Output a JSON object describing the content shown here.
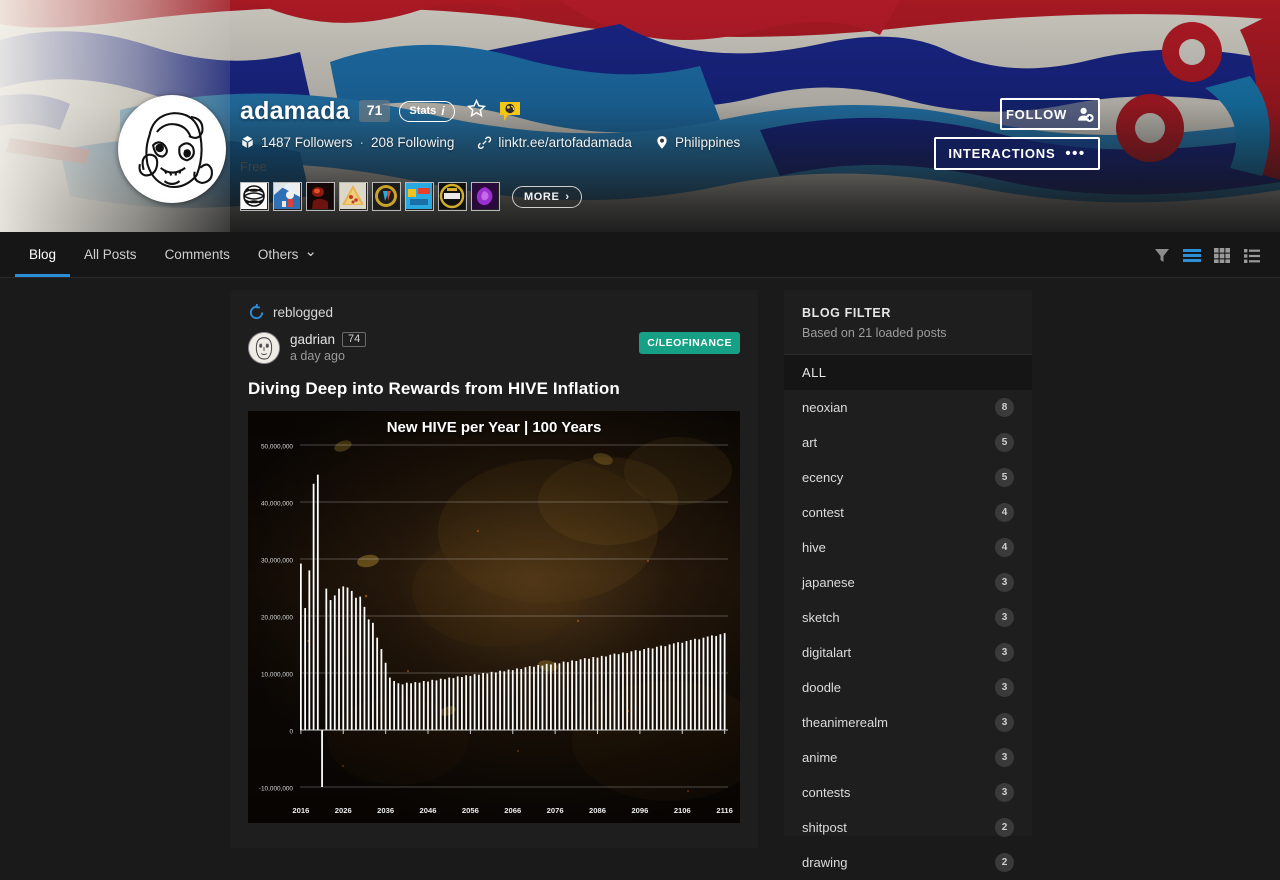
{
  "profile": {
    "username": "adamada",
    "reputation": "71",
    "stats_label": "Stats",
    "stats_info_glyph": "i",
    "followers": "1487 Followers",
    "separator": "·",
    "following": "208 Following",
    "link": "linktr.ee/artofadamada",
    "location": "Philippines",
    "free_label": "Free",
    "more_label": "MORE",
    "more_chevron": "›",
    "follow_label": "FOLLOW",
    "interactions_label": "INTERACTIONS",
    "interactions_dots": "•••",
    "icons": {
      "avatar": "avatar-line-art",
      "star": "star-icon",
      "bubble": "speech-bubble-badge-icon",
      "hive_glyph": "hive-followers-icon",
      "link": "link-icon",
      "location": "location-pin-icon",
      "follow": "add-user-icon"
    },
    "badges": [
      {
        "name": "badge-sphere",
        "c1": "#f2f2f2",
        "c2": "#141414"
      },
      {
        "name": "badge-astronaut",
        "c1": "#2f6fb5",
        "c2": "#e8e8e8"
      },
      {
        "name": "badge-dark-red",
        "c1": "#7d1414",
        "c2": "#e04a2a"
      },
      {
        "name": "badge-pizza",
        "c1": "#d8b26a",
        "c2": "#c9302c"
      },
      {
        "name": "badge-gold-circle",
        "c1": "#c9a227",
        "c2": "#1d1d1d"
      },
      {
        "name": "badge-blue-game",
        "c1": "#2aa8e0",
        "c2": "#f3c11c"
      },
      {
        "name": "badge-black-gold",
        "c1": "#d3b02a",
        "c2": "#111111"
      },
      {
        "name": "badge-purple-gem",
        "c1": "#9b30d0",
        "c2": "#2a0a3a"
      }
    ]
  },
  "nav": {
    "tabs": [
      {
        "label": "Blog",
        "name": "tab-blog",
        "active": true
      },
      {
        "label": "All Posts",
        "name": "tab-all-posts",
        "active": false
      },
      {
        "label": "Comments",
        "name": "tab-comments",
        "active": false
      },
      {
        "label": "Others",
        "name": "tab-others",
        "active": false,
        "chevron": "⌄"
      }
    ],
    "view_icons": [
      {
        "name": "filter-funnel-icon",
        "active": false
      },
      {
        "name": "list-view-icon",
        "active": true
      },
      {
        "name": "grid-view-icon",
        "active": false
      },
      {
        "name": "compact-list-view-icon",
        "active": false
      }
    ]
  },
  "post": {
    "reblogged_label": "reblogged",
    "reblog_icon": "reblog-arrow-icon",
    "author": "gadrian",
    "author_reputation": "74",
    "timestamp": "a day ago",
    "community": "C/LEOFINANCE",
    "title": "Diving Deep into Rewards from HIVE Inflation"
  },
  "chart_data": {
    "type": "bar",
    "title": "New HIVE per Year | 100 Years",
    "xlabel": "",
    "ylabel": "",
    "ylim": [
      -10000000,
      50000000
    ],
    "yticks": [
      50000000,
      40000000,
      30000000,
      20000000,
      10000000,
      0,
      -10000000
    ],
    "ytick_labels": [
      "50,000,000",
      "40,000,000",
      "30,000,000",
      "20,000,000",
      "10,000,000",
      "0",
      "-10,000,000"
    ],
    "xticks": [
      2016,
      2026,
      2036,
      2046,
      2056,
      2066,
      2076,
      2086,
      2096,
      2106,
      2116
    ],
    "xtick_labels": [
      "2016",
      "2026",
      "2036",
      "2046",
      "2056",
      "2066",
      "2076",
      "2086",
      "2096",
      "2106",
      "2116"
    ],
    "grid": true,
    "bar_color": "#ffffff",
    "x": [
      2016,
      2017,
      2018,
      2019,
      2020,
      2021,
      2022,
      2023,
      2024,
      2025,
      2026,
      2027,
      2028,
      2029,
      2030,
      2031,
      2032,
      2033,
      2034,
      2035,
      2036,
      2037,
      2038,
      2039,
      2040,
      2041,
      2042,
      2043,
      2044,
      2045,
      2046,
      2047,
      2048,
      2049,
      2050,
      2051,
      2052,
      2053,
      2054,
      2055,
      2056,
      2057,
      2058,
      2059,
      2060,
      2061,
      2062,
      2063,
      2064,
      2065,
      2066,
      2067,
      2068,
      2069,
      2070,
      2071,
      2072,
      2073,
      2074,
      2075,
      2076,
      2077,
      2078,
      2079,
      2080,
      2081,
      2082,
      2083,
      2084,
      2085,
      2086,
      2087,
      2088,
      2089,
      2090,
      2091,
      2092,
      2093,
      2094,
      2095,
      2096,
      2097,
      2098,
      2099,
      2100,
      2101,
      2102,
      2103,
      2104,
      2105,
      2106,
      2107,
      2108,
      2109,
      2110,
      2111,
      2112,
      2113,
      2114,
      2115,
      2116
    ],
    "values": [
      29200000,
      21400000,
      28000000,
      43200000,
      44800000,
      -10000000,
      24800000,
      22800000,
      23600000,
      24800000,
      25200000,
      25000000,
      24400000,
      23200000,
      23400000,
      21600000,
      19400000,
      18800000,
      16200000,
      14200000,
      11800000,
      9200000,
      8600000,
      8200000,
      8000000,
      8300000,
      8200000,
      8400000,
      8300000,
      8600000,
      8500000,
      8800000,
      8700000,
      9000000,
      8900000,
      9200000,
      9100000,
      9400000,
      9300000,
      9600000,
      9500000,
      9800000,
      9700000,
      10000000,
      9900000,
      10200000,
      10100000,
      10400000,
      10300000,
      10600000,
      10500000,
      10800000,
      10700000,
      11000000,
      11200000,
      11100000,
      11400000,
      11300000,
      11600000,
      11500000,
      11800000,
      11700000,
      12000000,
      11900000,
      12200000,
      12100000,
      12400000,
      12600000,
      12500000,
      12800000,
      12700000,
      13000000,
      12900000,
      13200000,
      13400000,
      13300000,
      13600000,
      13500000,
      13800000,
      14000000,
      13900000,
      14200000,
      14400000,
      14300000,
      14600000,
      14800000,
      14700000,
      15000000,
      15200000,
      15400000,
      15300000,
      15600000,
      15800000,
      16000000,
      15900000,
      16200000,
      16400000,
      16600000,
      16500000,
      16800000,
      17000000
    ]
  },
  "sidebar": {
    "title": "BLOG FILTER",
    "subtitle": "Based on 21 loaded posts",
    "all_label": "ALL",
    "items": [
      {
        "label": "neoxian",
        "count": "8"
      },
      {
        "label": "art",
        "count": "5"
      },
      {
        "label": "ecency",
        "count": "5"
      },
      {
        "label": "contest",
        "count": "4"
      },
      {
        "label": "hive",
        "count": "4"
      },
      {
        "label": "japanese",
        "count": "3"
      },
      {
        "label": "sketch",
        "count": "3"
      },
      {
        "label": "digitalart",
        "count": "3"
      },
      {
        "label": "doodle",
        "count": "3"
      },
      {
        "label": "theanimerealm",
        "count": "3"
      },
      {
        "label": "anime",
        "count": "3"
      },
      {
        "label": "contests",
        "count": "3"
      },
      {
        "label": "shitpost",
        "count": "2"
      },
      {
        "label": "drawing",
        "count": "2"
      }
    ]
  },
  "colors": {
    "accent": "#2b8fd8",
    "community": "#16a085",
    "page_bg": "#1a1a1a",
    "card_bg": "#1e1e1e"
  }
}
